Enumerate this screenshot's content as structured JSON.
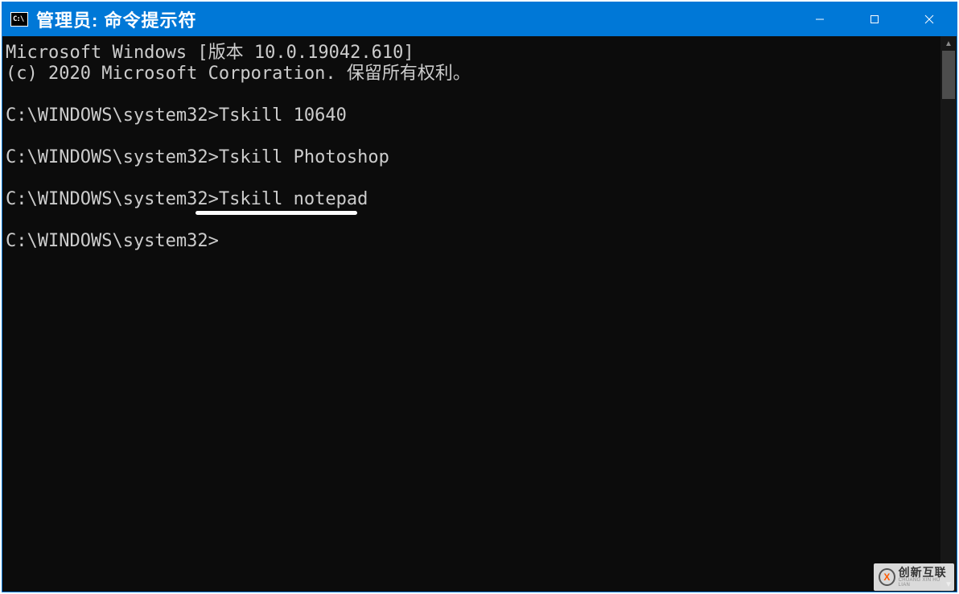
{
  "window": {
    "icon_glyph": "C:\\",
    "title": "管理员: 命令提示符"
  },
  "terminal": {
    "lines": [
      "Microsoft Windows [版本 10.0.19042.610]",
      "(c) 2020 Microsoft Corporation. 保留所有权利。",
      "",
      "C:\\WINDOWS\\system32>Tskill 10640",
      "",
      "C:\\WINDOWS\\system32>Tskill Photoshop",
      "",
      "C:\\WINDOWS\\system32>Tskill notepad",
      "",
      "C:\\WINDOWS\\system32>"
    ],
    "highlight_line_index": 7,
    "highlight_text": "Tskill notepad"
  },
  "watermark": {
    "logo_char": "X",
    "main": "创新互联",
    "sub": "CHUANG XIN HU LIAN"
  }
}
